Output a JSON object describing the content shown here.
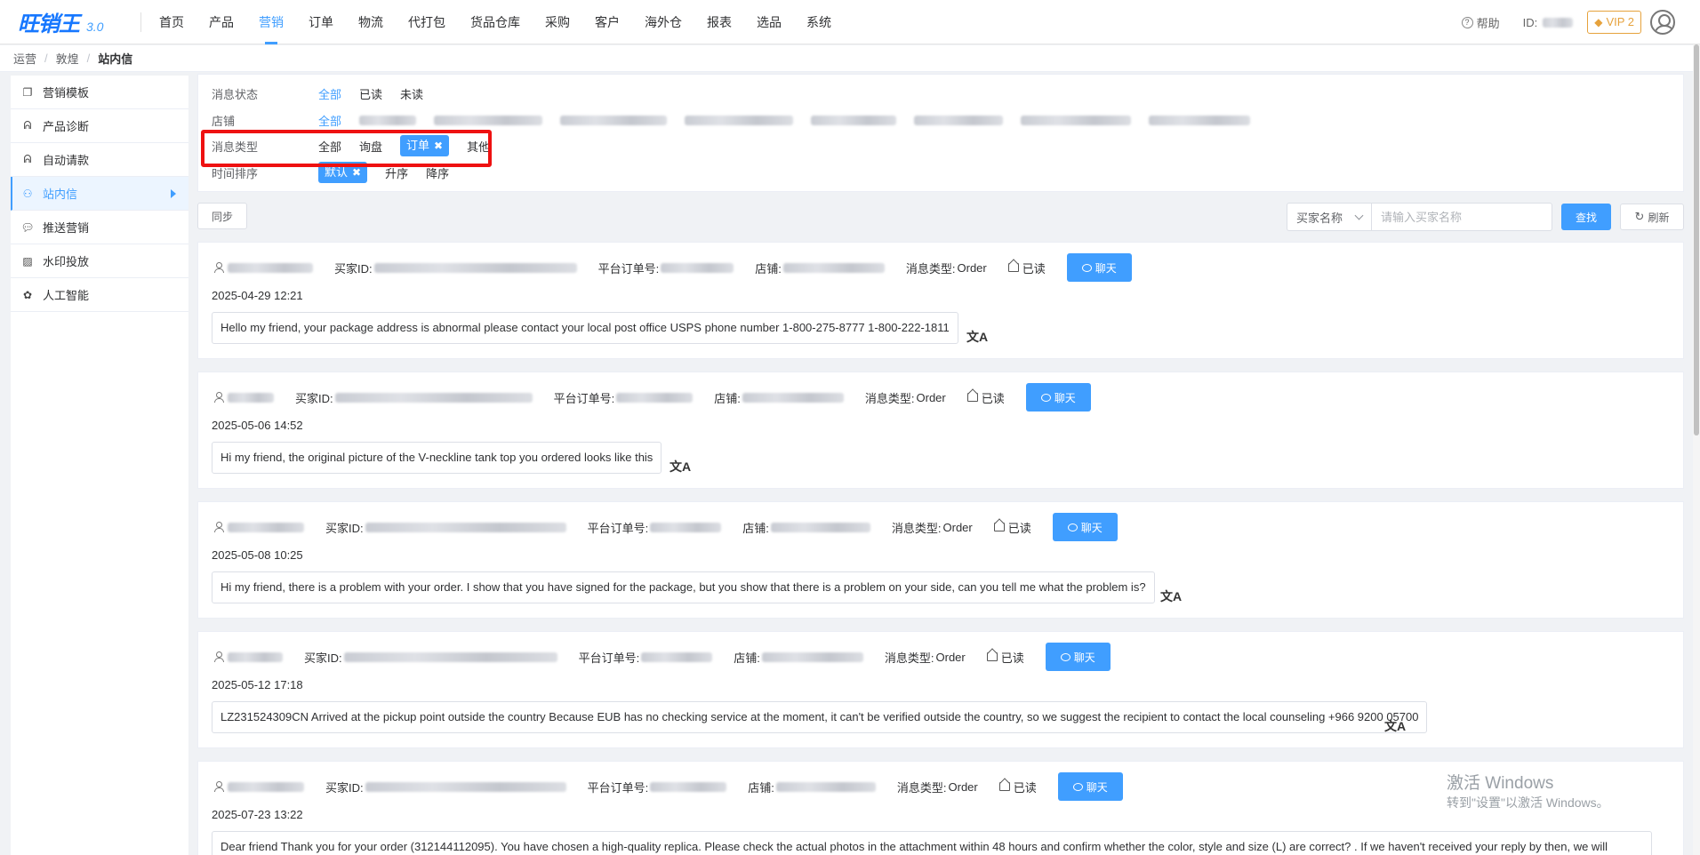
{
  "app": {
    "logo": "旺销王",
    "version": "3.0"
  },
  "nav": [
    "首页",
    "产品",
    "营销",
    "订单",
    "物流",
    "代打包",
    "货品仓库",
    "采购",
    "客户",
    "海外仓",
    "报表",
    "选品",
    "系统"
  ],
  "top_right": {
    "help": "帮助",
    "id_label": "ID:",
    "vip": "VIP 2"
  },
  "breadcrumb": [
    "运营",
    "敦煌",
    "站内信"
  ],
  "sidebar": [
    {
      "label": "营销模板",
      "icon": "template-icon"
    },
    {
      "label": "产品诊断",
      "icon": "stethoscope-icon"
    },
    {
      "label": "自动请款",
      "icon": "stethoscope-icon"
    },
    {
      "label": "站内信",
      "icon": "mailbox-icon"
    },
    {
      "label": "推送营销",
      "icon": "chat-bubble-icon"
    },
    {
      "label": "水印投放",
      "icon": "image-icon"
    },
    {
      "label": "人工智能",
      "icon": "ai-icon"
    }
  ],
  "filters": {
    "status": {
      "label": "消息状态",
      "options": [
        "全部",
        "已读",
        "未读"
      ]
    },
    "store": {
      "label": "店铺",
      "all": "全部"
    },
    "type": {
      "label": "消息类型",
      "options": [
        "全部",
        "询盘",
        "订单",
        "其他"
      ]
    },
    "sort": {
      "label": "时间排序",
      "options": [
        "默认",
        "升序",
        "降序"
      ]
    }
  },
  "toolbar": {
    "sync": "同步",
    "select_value": "买家名称",
    "search_placeholder": "请输入买家名称",
    "search": "查找",
    "refresh": "刷新"
  },
  "labels": {
    "buyer_id": "买家ID:",
    "order_no": "平台订单号:",
    "store": "店铺:",
    "msg_type": "消息类型:",
    "read": "已读",
    "chat": "聊天"
  },
  "messages": [
    {
      "type": "Order",
      "date": "2025-04-29 12:21",
      "text": "Hello my friend, your package address is abnormal please contact your local post office USPS phone number 1-800-275-8777 1-800-222-1811"
    },
    {
      "type": "Order",
      "date": "2025-05-06 14:52",
      "text": "Hi my friend, the original picture of the V-neckline tank top you ordered looks like this"
    },
    {
      "type": "Order",
      "date": "2025-05-08 10:25",
      "text": "Hi my friend, there is a problem with your order. I show that you have signed for the package, but you show that there is a problem on your side, can you tell me what the problem is?"
    },
    {
      "type": "Order",
      "date": "2025-05-12 17:18",
      "text": "LZ231524309CN Arrived at the pickup point outside the country Because EUB has no checking service at the moment, it can't be verified outside the country, so we suggest the recipient to contact the local counseling +966 9200 05700"
    },
    {
      "type": "Order",
      "date": "2025-07-23 13:22",
      "text": "Dear friend Thank you for your order (312144112095). You have chosen a high-quality replica. Please check the actual photos in the attachment within 48 hours and confirm whether the color, style and size (L) are correct? . If we haven't received your reply by then, we will"
    }
  ],
  "watermark": {
    "line1": "激活 Windows",
    "line2": "转到\"设置\"以激活 Windows。"
  },
  "colors": {
    "primary": "#409eff",
    "highlight": "#ee1111",
    "vip": "#e6a23c"
  }
}
